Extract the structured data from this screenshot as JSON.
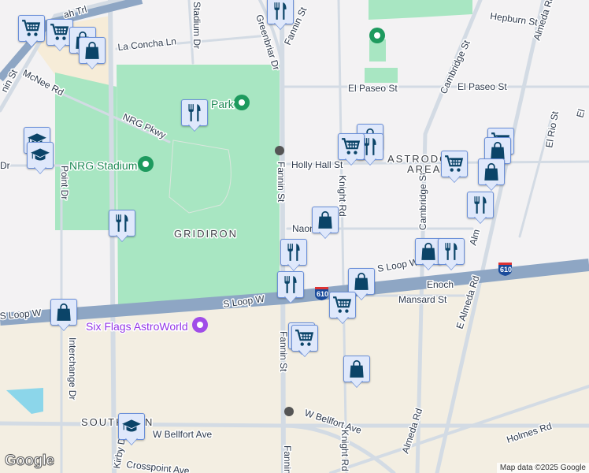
{
  "map": {
    "streets": {
      "ah_trl": "ah Trl",
      "nin_st_top_left": "nin St",
      "mcnee": "McNee Rd",
      "la_concha": "La Concha Ln",
      "stadium_dr": "Stadium Dr",
      "greenbriar": "Greenbriar Dr",
      "fannin_top": "Fannin St",
      "fannin_mid": "Fannin St",
      "fannin_low": "Fannin St",
      "fannin_bottom": "Fannin St",
      "hepburn": "Hepburn St",
      "almeda_top": "Almeda Rd",
      "cambridge_top": "Cambridge St",
      "cambridge_mid": "Cambridge St",
      "el_paseo_1": "El Paseo St",
      "el_paseo_2": "El Paseo St",
      "el_rio": "El Rio St",
      "nrg_pkwy": "NRG Pkwy",
      "holly_hall": "Holly Hall St",
      "knight_top": "Knight Rd",
      "knight_bottom": "Knight Rd",
      "naomi": "Naon",
      "point_dr": "Point Dr",
      "dr_left": "Dr",
      "s_loop_w_left": "S Loop W",
      "s_loop_w_mid": "S Loop W",
      "s_loop_w_right": "S Loop W",
      "interchange": "Interchange Dr",
      "w_bellfort_1": "W Bellfort Ave",
      "w_bellfort_2": "W Bellfort Ave",
      "kirby": "Kirby Dr",
      "crosspoint": "Crosspoint Ave",
      "enoch": "Enoch",
      "mansard": "Mansard St",
      "e_almeda": "E Almeda Rd",
      "almeda_bottom": "Almeda Rd",
      "holmes": "Holmes Rd",
      "alm_partial": "Alm",
      "el_partial": "El"
    },
    "areas": {
      "gridiron": "GRIDIRON",
      "astrodome_1": "ASTRODO",
      "astrodome_2": "AREA",
      "south_main": "SOUTH",
      "south_main_end": "N"
    },
    "pois": {
      "nrg_stadium": "NRG Stadium",
      "park": "Park",
      "six_flags": "Six Flags AstroWorld"
    },
    "highway_shield": "610",
    "highway_shield_2": "610",
    "colors": {
      "park": "#a8e6c2",
      "commercial": "#f3eee2",
      "highway": "#8ea6c4",
      "road": "#d3dbe4",
      "marker_fill": "#dfe8fb",
      "marker_icon": "#0b4468",
      "water": "#8cd6ea"
    }
  },
  "attribution": "Map data ©2025 Google",
  "logo": "Google"
}
